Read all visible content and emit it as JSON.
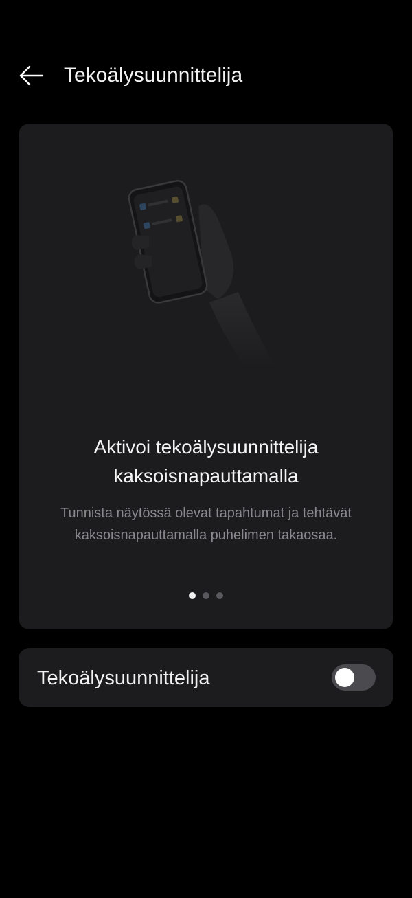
{
  "header": {
    "title": "Tekoälysuunnittelija",
    "back_icon": "arrow-left-icon"
  },
  "intro_card": {
    "illustration_icon": "hand-holding-phone-icon",
    "heading": "Aktivoi tekoälysuunnittelija\nkaksoisnapauttamalla",
    "description": "Tunnista näytössä olevat tapahtumat ja tehtävät\nkaksoisnapauttamalla puhelimen takaosaa.",
    "pager": {
      "total_pages": 3,
      "current_page": 1
    }
  },
  "setting": {
    "label": "Tekoälysuunnittelija",
    "enabled": false
  },
  "colors": {
    "background": "#000000",
    "card": "#1c1c1e",
    "text_primary": "#f2f2f2",
    "text_secondary": "#8a8a8e",
    "switch_track_off": "#4b4b4f"
  }
}
